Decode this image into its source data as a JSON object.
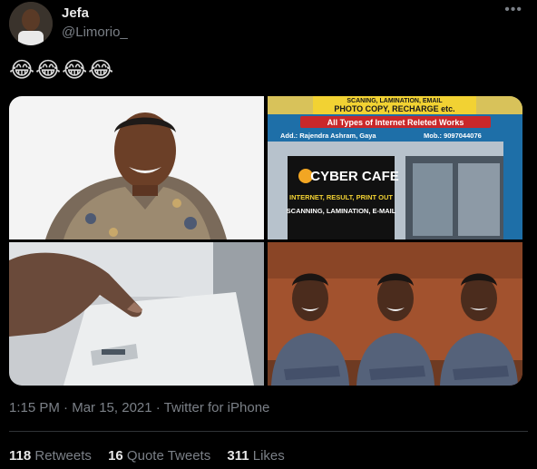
{
  "author": {
    "name": "Jefa",
    "handle": "@Limorio_"
  },
  "menu": {
    "more_label": "•••"
  },
  "tweet": {
    "text": "😂😂😂😂"
  },
  "media": {
    "shop_sign": {
      "top_line1": "SCANING, LAMINATION, EMAIL",
      "top_line2": "PHOTO COPY, RECHARGE etc.",
      "banner": "All Types of Internet Releted Works",
      "address": "Add.: Rajendra Ashram, Gaya",
      "mobile": "Mob.: 9097044076",
      "cafe_title": "CYBER CAFE",
      "cafe_line1": "INTERNET, RESULT, PRINT OUT",
      "cafe_line2": "SCANNING, LAMINATION, E-MAIL"
    }
  },
  "timestamp": {
    "time": "1:15 PM",
    "separator": " · ",
    "date": "Mar 15, 2021",
    "source": "Twitter for iPhone"
  },
  "stats": {
    "retweets_count": "118",
    "retweets_label": " Retweets",
    "quotes_count": "16",
    "quotes_label": " Quote Tweets",
    "likes_count": "311",
    "likes_label": " Likes"
  },
  "colors": {
    "background": "#000000",
    "secondary_text": "#7b8087",
    "primary_text": "#e8e8e8",
    "shop_banner": "#1e6fa8",
    "shop_sign_yellow": "#f2d233"
  }
}
